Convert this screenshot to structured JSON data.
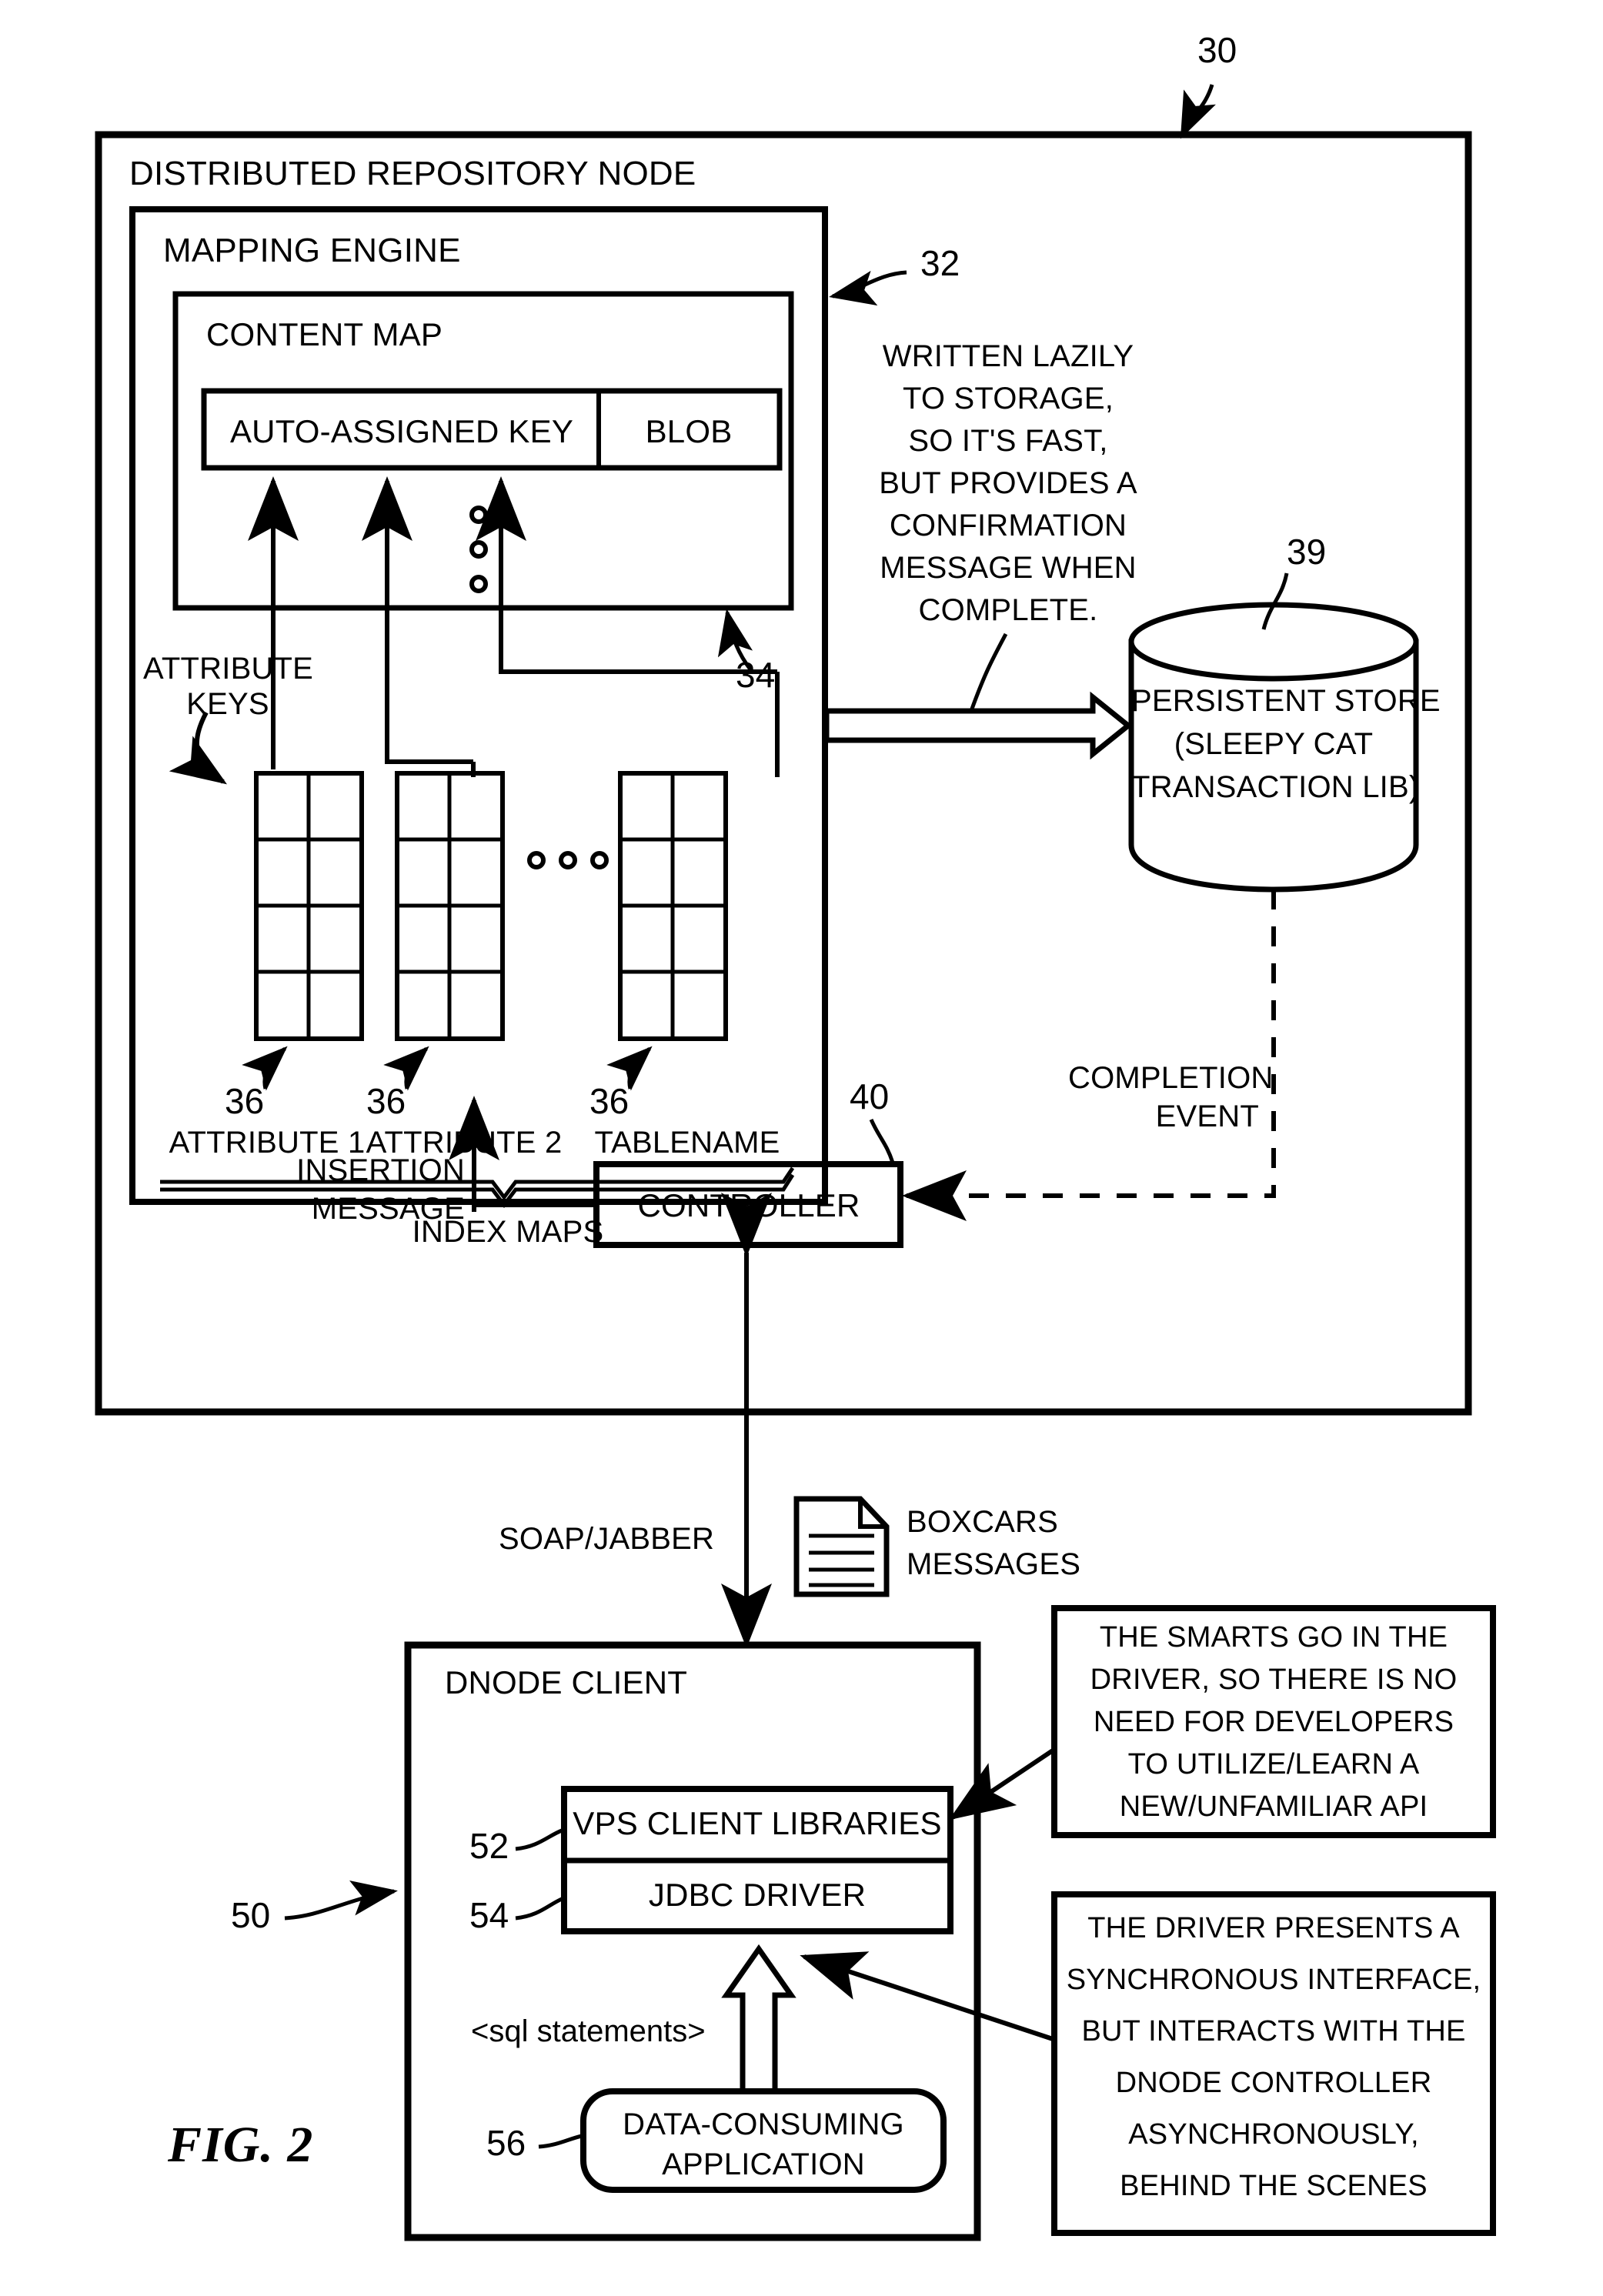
{
  "figure": {
    "label": "FIG. 2",
    "ref_30": "30",
    "ref_32": "32",
    "ref_34": "34",
    "ref_36_a": "36",
    "ref_36_b": "36",
    "ref_36_c": "36",
    "ref_39": "39",
    "ref_40": "40",
    "ref_50": "50",
    "ref_52": "52",
    "ref_54": "54",
    "ref_56": "56"
  },
  "repository_node": {
    "title": "DISTRIBUTED REPOSITORY NODE",
    "mapping_engine": {
      "title": "MAPPING ENGINE",
      "content_map": {
        "title": "CONTENT MAP",
        "columns": [
          "AUTO-ASSIGNED KEY",
          "BLOB"
        ],
        "ellipsis": "o o o"
      },
      "attribute_keys_label_line1": "ATTRIBUTE",
      "attribute_keys_label_line2": "KEYS",
      "index_maps_label": "INDEX MAPS",
      "index_maps": [
        {
          "name": "ATTRIBUTE 1",
          "ref": "36",
          "rows": 4,
          "cols": 2
        },
        {
          "name": "ATTRIBUTE 2",
          "ref": "36",
          "rows": 4,
          "cols": 2
        },
        {
          "name": "TABLENAME",
          "ref": "36",
          "rows": 4,
          "cols": 2
        }
      ],
      "index_maps_ellipsis": "o o o"
    },
    "lazy_write_note": [
      "WRITTEN LAZILY",
      "TO STORAGE,",
      "SO IT'S FAST,",
      "BUT PROVIDES A",
      "CONFIRMATION",
      "MESSAGE WHEN",
      "COMPLETE."
    ],
    "persistent_store": {
      "line1": "PERSISTENT STORE",
      "line2": "(SLEEPY CAT",
      "line3": "TRANSACTION LIB)"
    },
    "completion_event_line1": "COMPLETION",
    "completion_event_line2": "EVENT",
    "insertion_message_line1": "INSERTION",
    "insertion_message_line2": "MESSAGE",
    "controller": "CONTROLLER"
  },
  "transport": {
    "protocol_label": "SOAP/JABBER",
    "boxcars_line1": "BOXCARS",
    "boxcars_line2": "MESSAGES",
    "doc_icon": "document-icon"
  },
  "dnode_client": {
    "title": "DNODE CLIENT",
    "vps_client_libraries": "VPS CLIENT LIBRARIES",
    "jdbc_driver": "JDBC DRIVER",
    "sql_statements": "<sql statements>",
    "data_consuming_application_line1": "DATA-CONSUMING",
    "data_consuming_application_line2": "APPLICATION"
  },
  "callouts": [
    {
      "id": "smarts-note",
      "lines": [
        "THE SMARTS GO IN THE",
        "DRIVER, SO THERE IS NO",
        "NEED FOR DEVELOPERS",
        "TO UTILIZE/LEARN A",
        "NEW/UNFAMILIAR API"
      ]
    },
    {
      "id": "async-note",
      "lines": [
        "THE DRIVER PRESENTS A",
        "SYNCHRONOUS INTERFACE,",
        "BUT INTERACTS WITH THE",
        "DNODE CONTROLLER",
        "ASYNCHRONOUSLY,",
        "BEHIND THE SCENES"
      ]
    }
  ],
  "colors": {
    "ink": "#000000",
    "paper": "#ffffff"
  }
}
